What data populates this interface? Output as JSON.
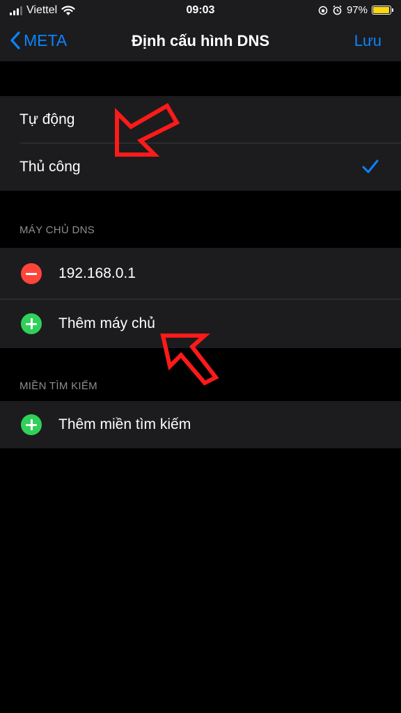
{
  "status_bar": {
    "carrier": "Viettel",
    "time": "09:03",
    "battery_percent": "97%",
    "battery_level": 0.97,
    "battery_color": "#ffd60a"
  },
  "nav": {
    "back_label": "META",
    "title": "Định cấu hình DNS",
    "save_label": "Lưu"
  },
  "mode": {
    "options": [
      "Tự động",
      "Thủ công"
    ],
    "selected": "Thủ công"
  },
  "dns_servers": {
    "header": "MÁY CHỦ DNS",
    "servers": [
      "192.168.0.1"
    ],
    "add_label": "Thêm máy chủ"
  },
  "search_domains": {
    "header": "MIỀN TÌM KIẾM",
    "add_label": "Thêm miền tìm kiếm"
  },
  "colors": {
    "accent": "#0a84ff",
    "remove": "#ff453a",
    "add": "#30d158",
    "annotation_arrow": "#ff1a1a"
  }
}
